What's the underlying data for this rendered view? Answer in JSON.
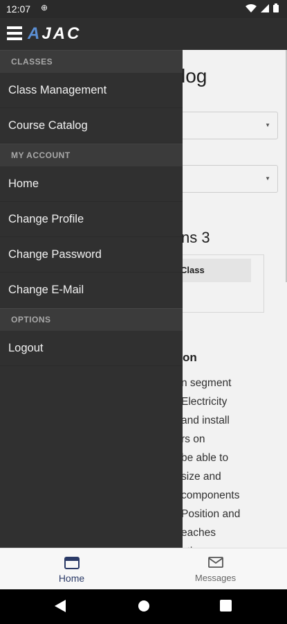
{
  "status_bar": {
    "time": "12:07"
  },
  "app_bar": {
    "logo_prefix": "A",
    "logo_text": "JAC"
  },
  "background": {
    "page_title": "log",
    "section_title": "ns 3",
    "card_header": "Class",
    "description_title": "on",
    "description_lines": [
      "n segment",
      " Electricity",
      "and install",
      "rs on",
      " be able to",
      " size and",
      "components",
      "Position and",
      "eaches",
      "ating"
    ]
  },
  "drawer": {
    "sections": [
      {
        "title": "CLASSES",
        "items": [
          "Class Management",
          "Course Catalog"
        ]
      },
      {
        "title": "MY ACCOUNT",
        "items": [
          "Home",
          "Change Profile",
          "Change Password",
          "Change E-Mail"
        ]
      },
      {
        "title": "OPTIONS",
        "items": [
          "Logout"
        ]
      }
    ]
  },
  "bottom_nav": {
    "tabs": [
      {
        "label": "Home",
        "icon": "browser-window-icon",
        "active": true
      },
      {
        "label": "Messages",
        "icon": "mail-icon",
        "active": false
      }
    ]
  },
  "colors": {
    "drawer_bg": "#303030",
    "section_bg": "#3b3b3b",
    "accent": "#2b3a67"
  }
}
